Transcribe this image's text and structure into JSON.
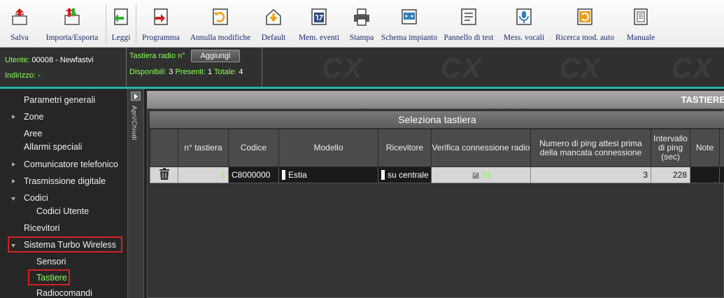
{
  "toolbar": {
    "buttons": [
      {
        "id": "salva",
        "label": "Salva",
        "icon": "save-icon"
      },
      {
        "id": "importa",
        "label": "Importa/Esporta",
        "icon": "import-export-icon"
      },
      {
        "id": "leggi",
        "label": "Leggi",
        "icon": "read-icon"
      },
      {
        "id": "programma",
        "label": "Programma",
        "icon": "program-icon"
      },
      {
        "id": "annulla",
        "label": "Annulla modifiche",
        "icon": "undo-icon"
      },
      {
        "id": "default",
        "label": "Default",
        "icon": "home-default-icon"
      },
      {
        "id": "mem",
        "label": "Mem. eventi",
        "icon": "event-memory-icon"
      },
      {
        "id": "stampa",
        "label": "Stampa",
        "icon": "print-icon"
      },
      {
        "id": "schema",
        "label": "Schema impianto",
        "icon": "system-schema-icon"
      },
      {
        "id": "pannello",
        "label": "Pannello di test",
        "icon": "test-panel-icon"
      },
      {
        "id": "mess",
        "label": "Mess. vocali",
        "icon": "microphone-icon"
      },
      {
        "id": "ricerca",
        "label": "Ricerca mod. auto",
        "icon": "auto-search-icon"
      },
      {
        "id": "manuale",
        "label": "Manuale",
        "icon": "manual-icon"
      }
    ]
  },
  "info": {
    "user_label": "Utente:",
    "user_value": "00008 - Newfastvi",
    "address_label": "Indirizzo:",
    "address_value": "-",
    "keypad_label": "Tastiera radio n°",
    "add_button": "Aggiungi",
    "available_label": "Disponibili:",
    "available_value": "3",
    "present_label": "Presenti:",
    "present_value": "1",
    "total_label": "Totale:",
    "total_value": "4",
    "watermark": "CX"
  },
  "sidebar": {
    "collapse_label": "Apri/Chiudi",
    "items": [
      {
        "label": "Parametri generali"
      },
      {
        "label": "Zone"
      },
      {
        "label": "Aree"
      },
      {
        "label": "Allarmi speciali"
      },
      {
        "label": "Comunicatore telefonico"
      },
      {
        "label": "Trasmissione digitale"
      },
      {
        "label": "Codici"
      },
      {
        "label": "Codici Utente"
      },
      {
        "label": "Ricevitori"
      },
      {
        "label": "Sistema Turbo Wireless"
      },
      {
        "label": "Sensori"
      },
      {
        "label": "Tastiere"
      },
      {
        "label": "Radiocomandi"
      }
    ]
  },
  "main": {
    "title": "TASTIERE",
    "panel_title": "Seleziona tastiera",
    "columns": [
      "",
      "n° tastiera",
      "Codice",
      "Modello",
      "Ricevitore",
      "Verifica connessione radio",
      "Numero di ping attesi prima della mancata connessione",
      "Intervallo di ping (sec)",
      "Note"
    ],
    "rows": [
      {
        "num": "1",
        "codice": "C8000000",
        "modello": "Estia",
        "ricevitore": "su centrale",
        "verifica": "Sì",
        "ping_attesi": "3",
        "intervallo": "228",
        "note": ""
      }
    ]
  },
  "colors": {
    "accent": "#8aff5a",
    "highlight": "#d42020",
    "teal": "#1fb5a5"
  }
}
